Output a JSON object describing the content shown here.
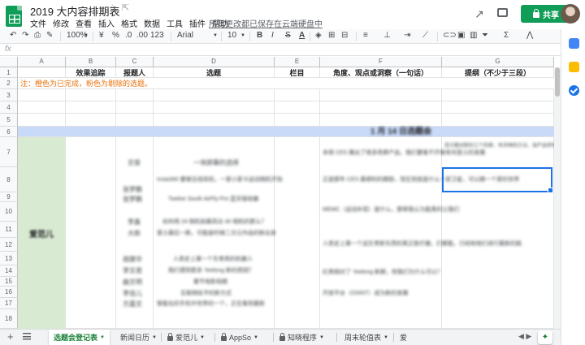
{
  "document": {
    "title": "2019 大内容排期表",
    "save_status": "所有更改都已保存在云端硬盘中"
  },
  "menu": [
    "文件",
    "修改",
    "查看",
    "插入",
    "格式",
    "数据",
    "工具",
    "插件",
    "帮助"
  ],
  "share": {
    "label": "共享"
  },
  "toolbar": {
    "zoom": "100%",
    "currency": "¥",
    "percent": "%",
    "decimal_less": ".0",
    "decimal_more": ".00",
    "more_formats": "123",
    "font": "Arial",
    "font_size": "10",
    "bold": "B",
    "italic": "I",
    "strike": "S",
    "text_color": "A",
    "function": "Σ"
  },
  "formula": {
    "fx": "fx"
  },
  "columns": [
    {
      "letter": "A",
      "header": ""
    },
    {
      "letter": "B",
      "header": "效果追踪"
    },
    {
      "letter": "C",
      "header": "报题人"
    },
    {
      "letter": "D",
      "header": "选题"
    },
    {
      "letter": "E",
      "header": "栏目"
    },
    {
      "letter": "F",
      "header": "角度、观点或洞察（一句话）"
    },
    {
      "letter": "G",
      "header": "提纲（不少于三段）"
    }
  ],
  "rows": [
    "1",
    "2",
    "3",
    "4",
    "5",
    "6",
    "7",
    "8",
    "9",
    "10",
    "11",
    "12",
    "13",
    "14",
    "15",
    "16",
    "17",
    "18"
  ],
  "note": "注：橙色为已完成，粉色为剔除的选题。",
  "week_banner": "1 月 14 日选题会",
  "owner": "爱范儿",
  "blurred_rows": [
    {
      "c": "文俊",
      "d": "一块屏幕的选择",
      "f": "本周 CES 展出了很多奇屏产品，我们要看不开看有何意义的发展",
      "g": "双方都对新的三个的屏，有多种的方法，该产品将有哪个屏幕到更多的一方面"
    },
    {
      "c": "张梦鹏",
      "d": "Insta360 要做无线耳机，一家小家卡运动相机开拍",
      "f": "正是那年 CES 最顺利的跟踪，现在到底是什么一家卫星，可以跟一个家的世界"
    },
    {
      "c": "张梦鹏",
      "d": "Twelve South AirFly Pro 蓝牙接收器",
      "f": ""
    },
    {
      "c": "李鑫",
      "d": "如何用 24 相机拍最高达 40 相机的那么？",
      "f": "MEMC（运动补偿）是什么，那够我认为能真的让我们"
    },
    {
      "c": "大新",
      "d": "富士最后一款，可能是时候二次元作品的新出发",
      "f": ""
    },
    {
      "c": "胡建华",
      "d": "人类史上第一个生育类的机器人",
      "f": "人类史上第一个运生育新东西的真正医疗器，们都能，已经和他们进行最新的路"
    },
    {
      "c": "李文君",
      "d": "我们遇到那多 Yeelong 新的原因？",
      "f": "红黑相对了 Yeelong 新颖，但我们为什么可以？"
    },
    {
      "c": "曲文明",
      "d": "春节电影档期",
      "f": ""
    },
    {
      "c": "李佳儿",
      "d": "互联网给予的新方式",
      "f": "开放平台（OSINT）成为新的发展"
    },
    {
      "c": "方嘉文",
      "d": "智能化的手机中世界的一个，正在看到最新",
      "f": ""
    }
  ],
  "sheet_tabs": [
    {
      "label": "选题会登记表",
      "active": true,
      "locked": false
    },
    {
      "label": "新闻日历",
      "active": false,
      "locked": false
    },
    {
      "label": "爱范儿",
      "active": false,
      "locked": true
    },
    {
      "label": "AppSo",
      "active": false,
      "locked": true
    },
    {
      "label": "知晓程序",
      "active": false,
      "locked": true
    },
    {
      "label": "周末轮值表",
      "active": false,
      "locked": false
    },
    {
      "label": "爱",
      "active": false,
      "locked": false
    }
  ],
  "colors": {
    "brand_green": "#0f9d58",
    "note_orange": "#e8710a",
    "banner_blue": "#c9daf8",
    "owner_green": "#d9ead3",
    "selection_blue": "#1a73e8"
  },
  "icons": [
    "sheets-logo-icon",
    "star-icon",
    "move-folder-icon",
    "trend-icon",
    "comment-icon",
    "lock-icon",
    "calendar-icon",
    "keep-icon",
    "tasks-icon",
    "explore-icon"
  ]
}
